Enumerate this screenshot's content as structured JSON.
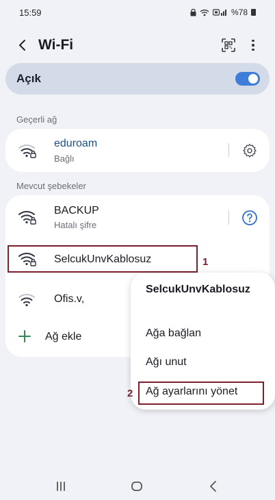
{
  "status_bar": {
    "time": "15:59",
    "battery": "%78"
  },
  "header": {
    "title": "Wi-Fi"
  },
  "wifi_toggle": {
    "label": "Açık",
    "on": true,
    "accent_color": "#3e7ed8"
  },
  "current_network": {
    "section_title": "Geçerli ağ",
    "name": "eduroam",
    "status": "Bağlı"
  },
  "available_networks": {
    "section_title": "Mevcut şebekeler",
    "items": [
      {
        "name": "BACKUP",
        "status": "Hatalı şifre"
      },
      {
        "name": "SelcukUnvKablosuz",
        "status": ""
      },
      {
        "name": "Ofis.v,",
        "status": ""
      }
    ],
    "add_label": "Ağ ekle"
  },
  "context_menu": {
    "title": "SelcukUnvKablosuz",
    "items": [
      {
        "label": "Ağa bağlan"
      },
      {
        "label": "Ağı unut"
      },
      {
        "label": "Ağ ayarlarını yönet"
      }
    ]
  },
  "annotations": {
    "step1": "1",
    "step2": "2",
    "color": "#7a1f2c"
  }
}
